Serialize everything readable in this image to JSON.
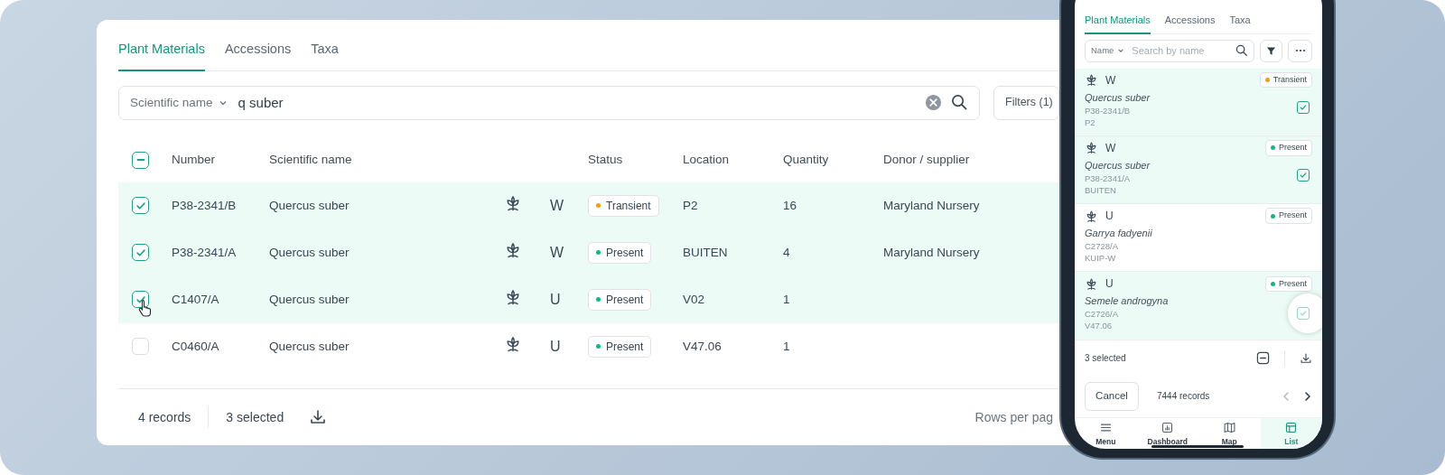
{
  "desktop": {
    "tabs": [
      {
        "label": "Plant Materials",
        "selected": true
      },
      {
        "label": "Accessions",
        "selected": false
      },
      {
        "label": "Taxa",
        "selected": false
      }
    ],
    "search": {
      "field_selector": "Scientific name",
      "value": "q suber"
    },
    "filters_button": "Filters (1)",
    "table": {
      "select_all": {
        "indeterminate": true
      },
      "columns": [
        "Number",
        "Scientific name",
        "Status",
        "Location",
        "Quantity",
        "Donor / supplier"
      ],
      "rows": [
        {
          "number": "P38-2341/B",
          "scientific_name": "Quercus suber",
          "column_4": "W",
          "status": {
            "label": "Transient",
            "color": "#f59e0b"
          },
          "location": "P2",
          "quantity": "16",
          "donor": "Maryland Nursery",
          "selected": true,
          "pointer": false
        },
        {
          "number": "P38-2341/A",
          "scientific_name": "Quercus suber",
          "column_4": "W",
          "status": {
            "label": "Present",
            "color": "#10b981"
          },
          "location": "BUITEN",
          "quantity": "4",
          "donor": "Maryland Nursery",
          "selected": true,
          "pointer": false
        },
        {
          "number": "C1407/A",
          "scientific_name": "Quercus suber",
          "column_4": "U",
          "status": {
            "label": "Present",
            "color": "#10b981"
          },
          "location": "V02",
          "quantity": "1",
          "selected": true,
          "pointer": true
        },
        {
          "number": "C0460/A",
          "scientific_name": "Quercus suber",
          "column_4": "U",
          "status": {
            "label": "Present",
            "color": "#10b981"
          },
          "location": "V47.06",
          "quantity": "1",
          "selected": false,
          "pointer": false
        }
      ]
    },
    "footer": {
      "records": "4 records",
      "selected": "3 selected",
      "rows_per_page": "Rows per pag"
    }
  },
  "phone": {
    "tabs": [
      {
        "label": "Plant Materials",
        "selected": true
      },
      {
        "label": "Accessions",
        "selected": false
      },
      {
        "label": "Taxa",
        "selected": false
      }
    ],
    "search": {
      "field_selector": "Name",
      "placeholder": "Search by name"
    },
    "cards": [
      {
        "code": "W",
        "status": {
          "label": "Transient",
          "color": "#f59e0b"
        },
        "scientific_name": "Quercus suber",
        "number": "P38-2341/B",
        "location": "P2",
        "selected": true,
        "pressed": false
      },
      {
        "code": "W",
        "status": {
          "label": "Present",
          "color": "#10b981"
        },
        "scientific_name": "Quercus suber",
        "number": "P38-2341/A",
        "location": "BUITEN",
        "selected": true,
        "pressed": false
      },
      {
        "code": "U",
        "status": {
          "label": "Present",
          "color": "#10b981"
        },
        "scientific_name": "Garrya fadyenii",
        "number": "C2728/A",
        "location": "KUIP-W",
        "selected": false,
        "pressed": false
      },
      {
        "code": "U",
        "status": {
          "label": "Present",
          "color": "#10b981"
        },
        "scientific_name": "Semele androgyna",
        "number": "C2726/A",
        "location": "V47.06",
        "selected": true,
        "pressed": true
      }
    ],
    "selection_bar": {
      "count": "3 selected"
    },
    "pager": {
      "cancel": "Cancel",
      "records": "7444 records",
      "previous_disabled": true,
      "next_disabled": false
    },
    "nav": [
      {
        "label": "Menu",
        "kind": "menu",
        "selected": false
      },
      {
        "label": "Dashboard",
        "kind": "dashboard",
        "selected": false
      },
      {
        "label": "Map",
        "kind": "map",
        "selected": false
      },
      {
        "label": "List",
        "kind": "list",
        "selected": true
      }
    ]
  }
}
